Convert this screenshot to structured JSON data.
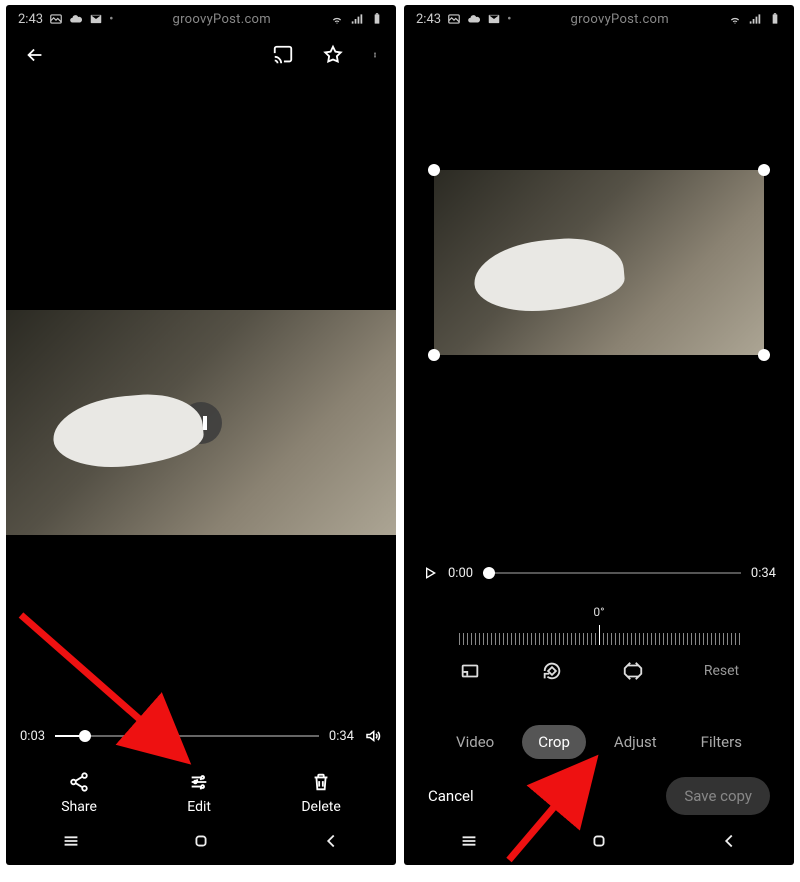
{
  "status": {
    "time": "2:43",
    "watermark": "groovyPost.com"
  },
  "viewer": {
    "current_time": "0:03",
    "duration": "0:34",
    "progress_pct": 9,
    "actions": {
      "share": "Share",
      "edit": "Edit",
      "delete": "Delete"
    }
  },
  "editor": {
    "current_time": "0:00",
    "duration": "0:34",
    "rotation_label": "0°",
    "reset_label": "Reset",
    "tabs": {
      "video": "Video",
      "crop": "Crop",
      "adjust": "Adjust",
      "filters": "Filters"
    },
    "active_tab": "crop",
    "cancel_label": "Cancel",
    "save_label": "Save copy"
  },
  "annotations": {
    "arrow_color": "#e11"
  }
}
